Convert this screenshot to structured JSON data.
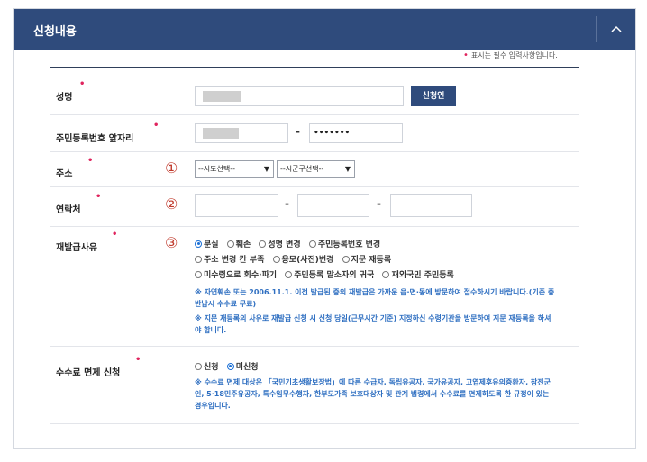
{
  "header": {
    "title": "신청내용",
    "toggle_icon": "chevron-up-icon"
  },
  "required_note": "표시는 필수 입력사항입니다.",
  "fields": {
    "name": {
      "label": "성명",
      "button": "신청인"
    },
    "rrn": {
      "label": "주민등록번호 앞자리",
      "dash": "-",
      "masked": "•••••••"
    },
    "address": {
      "label": "주소",
      "num": "①",
      "sido": "--시도선택--",
      "sigungu": "--시군구선택--"
    },
    "contact": {
      "label": "연락처",
      "num": "②",
      "dash1": "-",
      "dash2": "-"
    },
    "reason": {
      "label": "재발급사유",
      "num": "③",
      "options_row1": [
        "분실",
        "훼손",
        "성명 변경",
        "주민등록번호 변경"
      ],
      "options_row2": [
        "주소 변경 칸 부족",
        "용모(사진)변경",
        "지문 재등록"
      ],
      "options_row3": [
        "미수령으로 회수·파기",
        "주민등록 말소자의 귀국",
        "재외국민 주민등록"
      ],
      "selected": "분실",
      "note1_line1": "※ 자연훼손 또는 2006.11.1. 이전 발급된 증의 재발급은 가까운 읍·면·동에 방문하여 접수하시기 바랍니다.(기존 증",
      "note1_line2": "반납시 수수료 무료)",
      "note2_line1": "※ 지문 재등록의 사유로 재발급 신청 시 신청 당일(근무시간 기준) 지정하신 수령기관을 방문하여 지문 재등록을 하셔",
      "note2_line2": "야 합니다."
    },
    "fee": {
      "label": "수수료 면제 신청",
      "options": [
        "신청",
        "미신청"
      ],
      "selected": "미신청",
      "note_line1": "※ 수수료 면제 대상은 「국민기초생활보장법」에 따른 수급자, 독립유공자, 국가유공자, 고엽제후유의증환자, 참전군",
      "note_line2": "인, 5·18민주유공자, 특수임무수행자, 한부모가족 보호대상자 및 관계 법령에서 수수료를 면제하도록 한 규정이 있는",
      "note_line3": "경우입니다."
    }
  },
  "colors": {
    "header_bg": "#2f4b7c",
    "accent_blue": "#2f6fc1",
    "required_red": "#e0245e",
    "number_red": "#c0392b"
  }
}
